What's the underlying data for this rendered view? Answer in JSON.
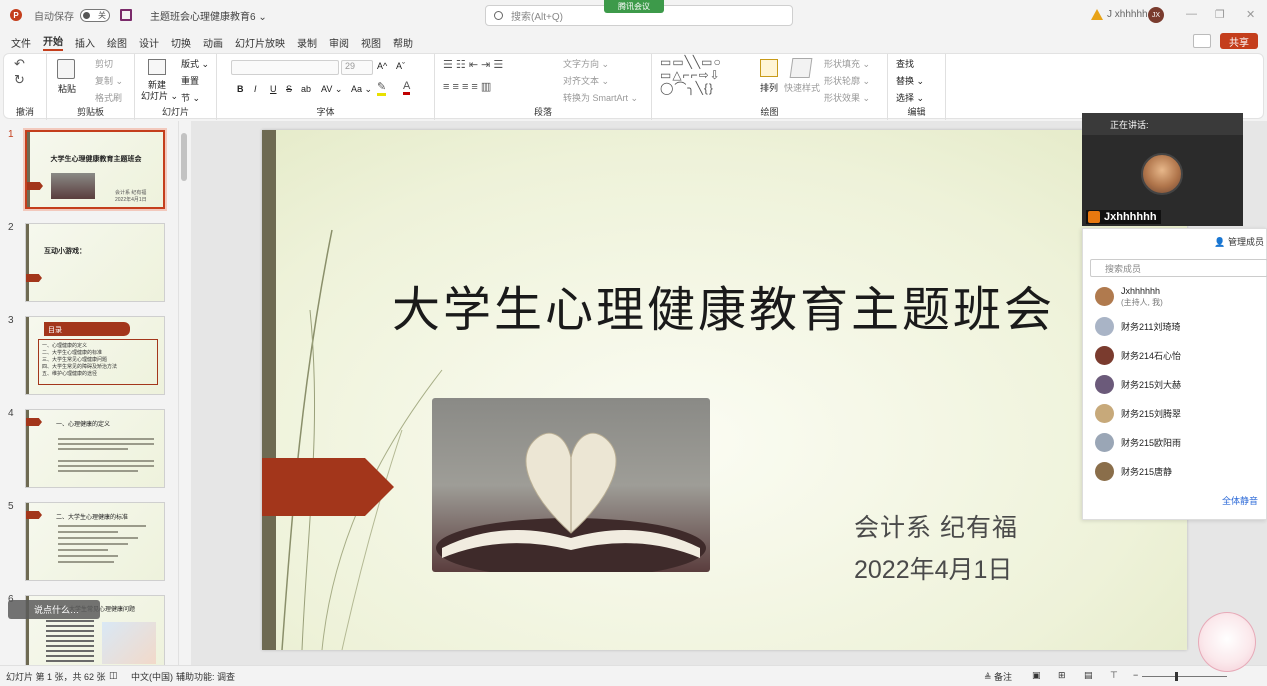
{
  "titlebar": {
    "autosave_label": "自动保存",
    "autosave_state": "关",
    "doc_title": "主题班会心理健康教育6 ⌄",
    "search_placeholder": "搜索(Alt+Q)",
    "meeting_tag": "腾讯会议",
    "user_name": "J xhhhhh",
    "user_initials": "JX",
    "min": "—",
    "restore": "❐",
    "close": "✕"
  },
  "menu": {
    "items": [
      "文件",
      "开始",
      "插入",
      "绘图",
      "设计",
      "切换",
      "动画",
      "幻灯片放映",
      "录制",
      "审阅",
      "视图",
      "帮助"
    ],
    "active": "开始",
    "share_label": "共享"
  },
  "ribbon": {
    "groups": {
      "undo": "撤消",
      "clipboard": "剪贴板",
      "slides": "幻灯片",
      "font": "字体",
      "paragraph": "段落",
      "drawing": "绘图",
      "editing": "编辑"
    },
    "clipboard": {
      "paste": "粘贴",
      "cut": "剪切",
      "copy": "复制 ⌄",
      "format_painter": "格式刷"
    },
    "slides": {
      "new_slide": "新建",
      "new_slide_sub": "幻灯片 ⌄",
      "layout": "版式 ⌄",
      "reset": "重置",
      "section": "节 ⌄"
    },
    "font": {
      "size": "29",
      "grow": "A^",
      "shrink": "Aˇ",
      "bold": "B",
      "italic": "I",
      "underline": "U",
      "strike": "S",
      "shadow": "ab",
      "spacing": "AV ⌄",
      "case": "Aa ⌄"
    },
    "paragraph": {
      "text_direction": "文字方向 ⌄",
      "align_text": "对齐文本 ⌄",
      "smartart": "转换为 SmartArt ⌄"
    },
    "drawing": {
      "arrange": "排列",
      "quick_styles": "快速样式",
      "fill": "形状填充 ⌄",
      "outline": "形状轮廓 ⌄",
      "effects": "形状效果 ⌄"
    },
    "editing": {
      "find": "查找",
      "replace": "替换 ⌄",
      "select": "选择 ⌄"
    }
  },
  "thumbnails": [
    {
      "num": "1",
      "title": "大学生心理健康教育主题班会",
      "subtitle": "会计系 纪有福\n2022年4月1日"
    },
    {
      "num": "2",
      "title": "互动小游戏："
    },
    {
      "num": "3",
      "title": "目录",
      "lines": [
        "一、心理健康的定义",
        "二、大学生心理健康的标准",
        "三、大学生常见心理健康问题",
        "四、大学生常见的障碍及矫治方法",
        "五、维护心理健康的途径"
      ]
    },
    {
      "num": "4",
      "title": "一、心理健康的定义"
    },
    {
      "num": "5",
      "title": "二、大学生心理健康的标准"
    },
    {
      "num": "6",
      "title": "三、大学生常见心理健康问题"
    }
  ],
  "quiz_chip": "说点什么…",
  "slide": {
    "title": "大学生心理健康教育主题班会",
    "author": "会计系 纪有福",
    "date": "2022年4月1日"
  },
  "meeting": {
    "speaking_label": "正在讲话:",
    "speaker_name": "Jxhhhhhh",
    "manage_label": "管理成员",
    "search_placeholder": "搜索成员",
    "members": [
      {
        "name": "Jxhhhhhh",
        "sub": "(主持人, 我)",
        "color": "#b07a4e"
      },
      {
        "name": "财务211刘琦琦",
        "sub": "",
        "color": "#a9b4c6"
      },
      {
        "name": "财务214石心怡",
        "sub": "",
        "color": "#7a3b2e"
      },
      {
        "name": "财务215刘大赫",
        "sub": "",
        "color": "#6b5a7a"
      },
      {
        "name": "财务215刘腾翠",
        "sub": "",
        "color": "#c7a97a"
      },
      {
        "name": "财务215欧阳雨",
        "sub": "",
        "color": "#9aa6b6"
      },
      {
        "name": "财务215唐静",
        "sub": "",
        "color": "#8a6e4a"
      }
    ],
    "mute_all": "全体静音"
  },
  "status": {
    "slide_info": "幻灯片 第 1 张，共 62 张",
    "language": "中文(中国)",
    "accessibility": "辅助功能: 调查",
    "notes": "备注"
  },
  "colors": {
    "accent": "#c43e1c",
    "slide_arrow": "#a3361b",
    "slide_stripe": "#6e6a52"
  }
}
